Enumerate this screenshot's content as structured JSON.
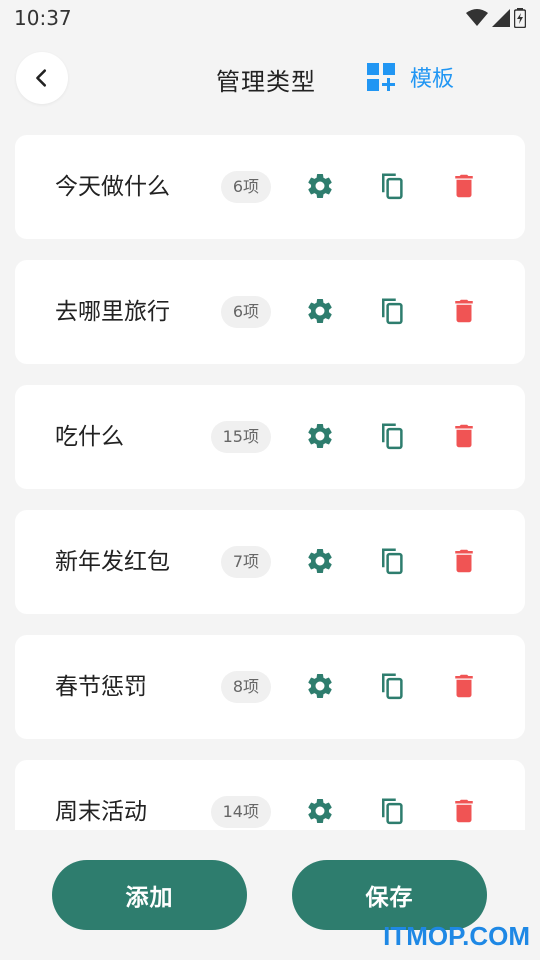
{
  "status_bar": {
    "time": "10:37"
  },
  "header": {
    "title": "管理类型",
    "template_label": "模板"
  },
  "items": [
    {
      "name": "今天做什么",
      "count": "6项"
    },
    {
      "name": "去哪里旅行",
      "count": "6项"
    },
    {
      "name": "吃什么",
      "count": "15项"
    },
    {
      "name": "新年发红包",
      "count": "7项"
    },
    {
      "name": "春节惩罚",
      "count": "8项"
    },
    {
      "name": "周末活动",
      "count": "14项"
    }
  ],
  "actions": {
    "add_label": "添加",
    "save_label": "保存"
  },
  "watermark": "ITMOP.COM",
  "colors": {
    "primary": "#2e7d6e",
    "accent_blue": "#2196f3",
    "delete_red": "#f05454",
    "background": "#f4f4f4"
  },
  "icons": {
    "settings": "gear-icon",
    "copy": "copy-icon",
    "delete": "trash-icon",
    "back": "chevron-left-icon",
    "template": "dashboard-add-icon"
  }
}
